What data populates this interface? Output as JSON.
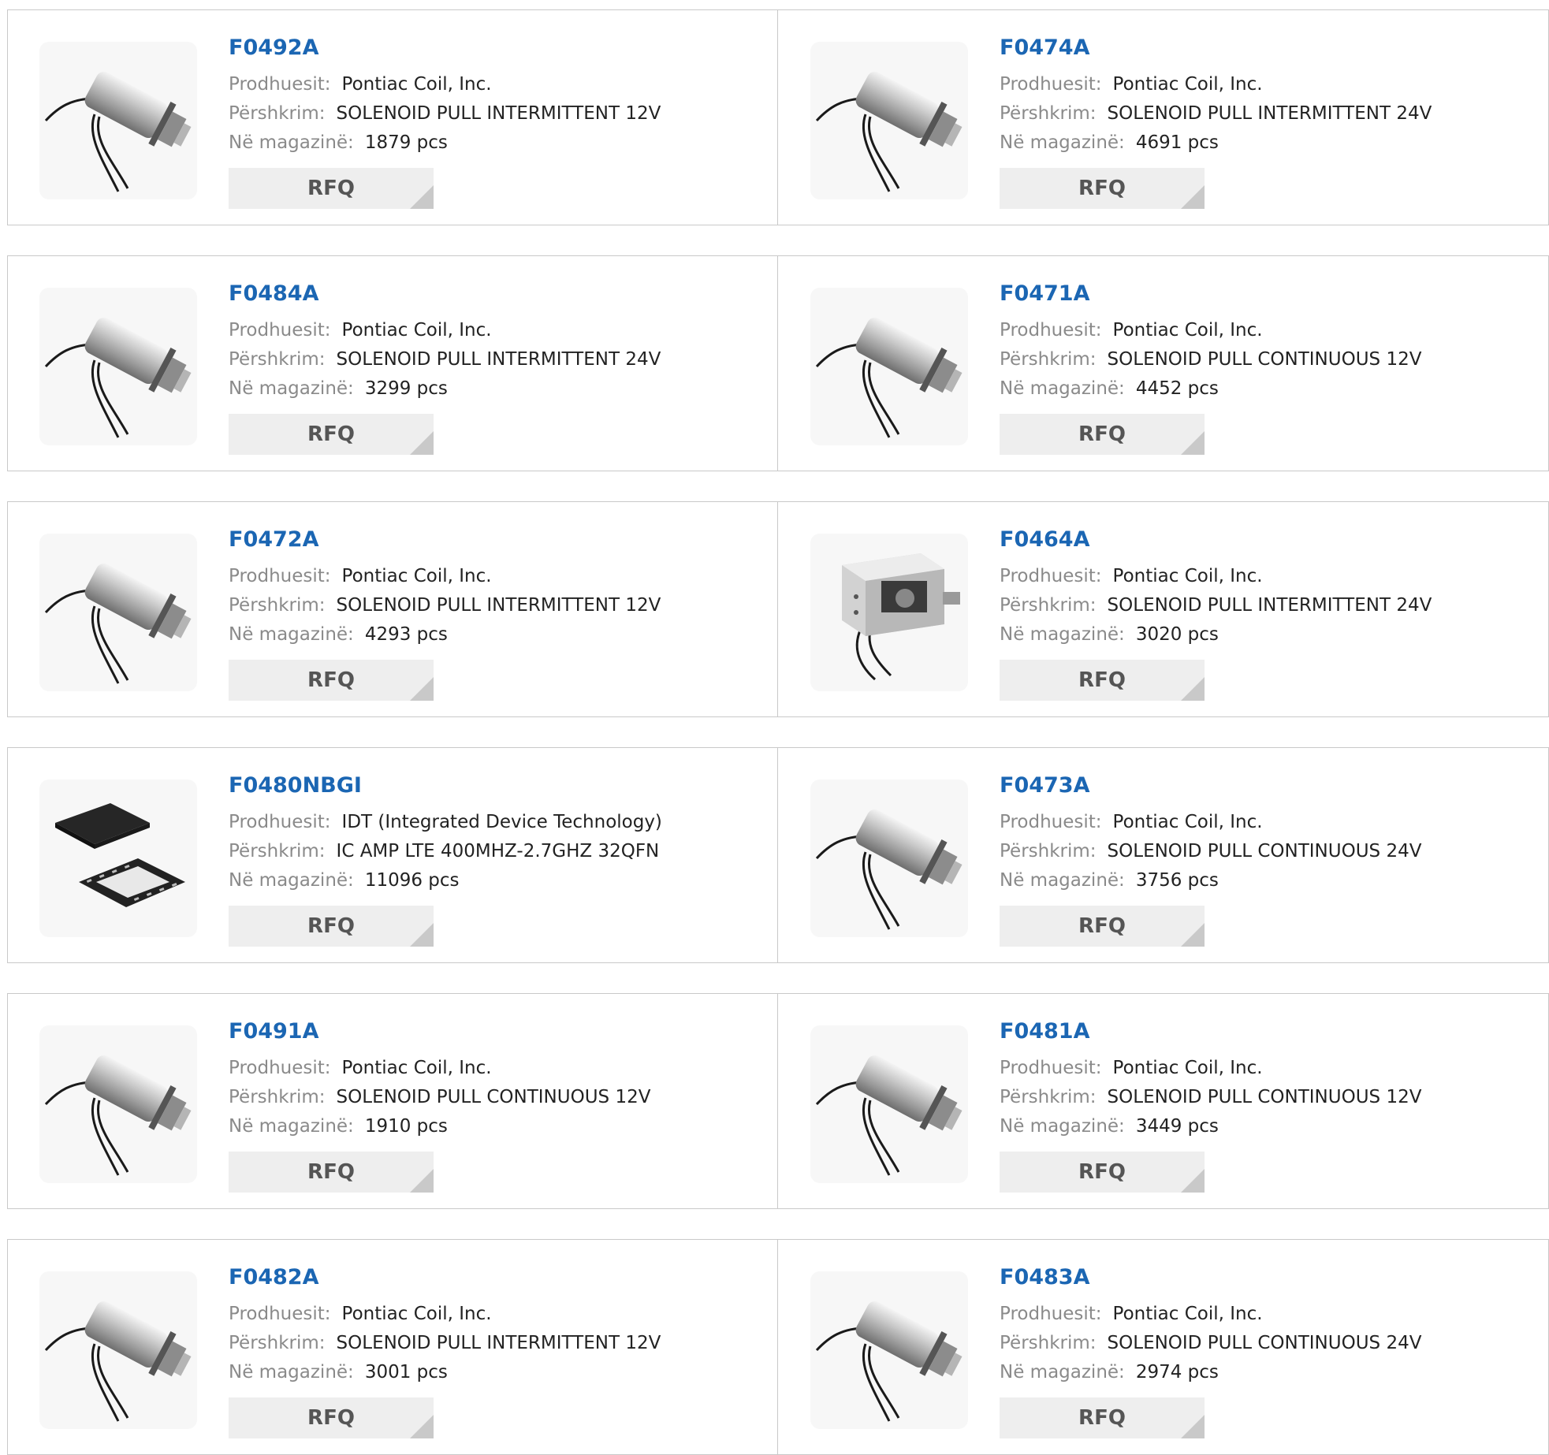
{
  "products": [
    {
      "part_number": "F0492A",
      "manufacturer_label": "Prodhuesit:",
      "manufacturer": "Pontiac Coil, Inc.",
      "description_label": "Përshkrim:",
      "description": "SOLENOID PULL INTERMITTENT 12V",
      "stock_label": "Në magazinë:",
      "stock": "1879 pcs",
      "rfq_label": "RFQ",
      "image": "solenoid-icon"
    },
    {
      "part_number": "F0474A",
      "manufacturer_label": "Prodhuesit:",
      "manufacturer": "Pontiac Coil, Inc.",
      "description_label": "Përshkrim:",
      "description": "SOLENOID PULL INTERMITTENT 24V",
      "stock_label": "Në magazinë:",
      "stock": "4691 pcs",
      "rfq_label": "RFQ",
      "image": "solenoid-icon"
    },
    {
      "part_number": "F0484A",
      "manufacturer_label": "Prodhuesit:",
      "manufacturer": "Pontiac Coil, Inc.",
      "description_label": "Përshkrim:",
      "description": "SOLENOID PULL INTERMITTENT 24V",
      "stock_label": "Në magazinë:",
      "stock": "3299 pcs",
      "rfq_label": "RFQ",
      "image": "solenoid-icon"
    },
    {
      "part_number": "F0471A",
      "manufacturer_label": "Prodhuesit:",
      "manufacturer": "Pontiac Coil, Inc.",
      "description_label": "Përshkrim:",
      "description": "SOLENOID PULL CONTINUOUS 12V",
      "stock_label": "Në magazinë:",
      "stock": "4452 pcs",
      "rfq_label": "RFQ",
      "image": "solenoid-icon"
    },
    {
      "part_number": "F0472A",
      "manufacturer_label": "Prodhuesit:",
      "manufacturer": "Pontiac Coil, Inc.",
      "description_label": "Përshkrim:",
      "description": "SOLENOID PULL INTERMITTENT 12V",
      "stock_label": "Në magazinë:",
      "stock": "4293 pcs",
      "rfq_label": "RFQ",
      "image": "solenoid-icon"
    },
    {
      "part_number": "F0464A",
      "manufacturer_label": "Prodhuesit:",
      "manufacturer": "Pontiac Coil, Inc.",
      "description_label": "Përshkrim:",
      "description": "SOLENOID PULL INTERMITTENT 24V",
      "stock_label": "Në magazinë:",
      "stock": "3020 pcs",
      "rfq_label": "RFQ",
      "image": "box-solenoid-icon"
    },
    {
      "part_number": "F0480NBGI",
      "manufacturer_label": "Prodhuesit:",
      "manufacturer": "IDT (Integrated Device Technology)",
      "description_label": "Përshkrim:",
      "description": "IC AMP LTE 400MHZ-2.7GHZ 32QFN",
      "stock_label": "Në magazinë:",
      "stock": "11096 pcs",
      "rfq_label": "RFQ",
      "image": "qfn-chip-icon"
    },
    {
      "part_number": "F0473A",
      "manufacturer_label": "Prodhuesit:",
      "manufacturer": "Pontiac Coil, Inc.",
      "description_label": "Përshkrim:",
      "description": "SOLENOID PULL CONTINUOUS 24V",
      "stock_label": "Në magazinë:",
      "stock": "3756 pcs",
      "rfq_label": "RFQ",
      "image": "solenoid-icon"
    },
    {
      "part_number": "F0491A",
      "manufacturer_label": "Prodhuesit:",
      "manufacturer": "Pontiac Coil, Inc.",
      "description_label": "Përshkrim:",
      "description": "SOLENOID PULL CONTINUOUS 12V",
      "stock_label": "Në magazinë:",
      "stock": "1910 pcs",
      "rfq_label": "RFQ",
      "image": "solenoid-icon"
    },
    {
      "part_number": "F0481A",
      "manufacturer_label": "Prodhuesit:",
      "manufacturer": "Pontiac Coil, Inc.",
      "description_label": "Përshkrim:",
      "description": "SOLENOID PULL CONTINUOUS 12V",
      "stock_label": "Në magazinë:",
      "stock": "3449 pcs",
      "rfq_label": "RFQ",
      "image": "solenoid-icon"
    },
    {
      "part_number": "F0482A",
      "manufacturer_label": "Prodhuesit:",
      "manufacturer": "Pontiac Coil, Inc.",
      "description_label": "Përshkrim:",
      "description": "SOLENOID PULL INTERMITTENT 12V",
      "stock_label": "Në magazinë:",
      "stock": "3001 pcs",
      "rfq_label": "RFQ",
      "image": "solenoid-icon"
    },
    {
      "part_number": "F0483A",
      "manufacturer_label": "Prodhuesit:",
      "manufacturer": "Pontiac Coil, Inc.",
      "description_label": "Përshkrim:",
      "description": "SOLENOID PULL CONTINUOUS 24V",
      "stock_label": "Në magazinë:",
      "stock": "2974 pcs",
      "rfq_label": "RFQ",
      "image": "solenoid-icon"
    }
  ],
  "colors": {
    "part_number": "#1b66b3",
    "label": "#8a8a8a",
    "value": "#222222",
    "rfq_bg": "#eeeeee",
    "rfq_text": "#555555",
    "border": "#c9c9c9"
  }
}
